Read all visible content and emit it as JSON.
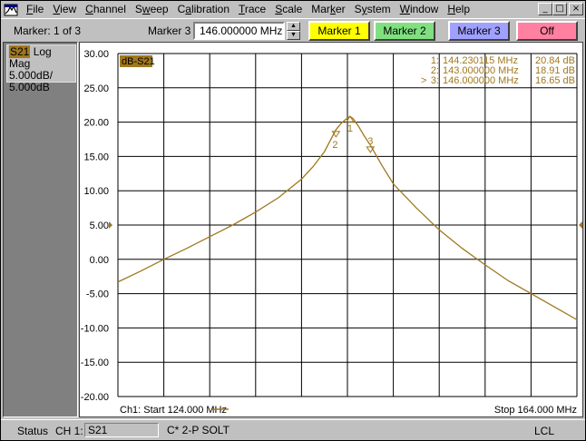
{
  "menu": [
    "File",
    "View",
    "Channel",
    "Sweep",
    "Calibration",
    "Trace",
    "Scale",
    "Marker",
    "System",
    "Window",
    "Help"
  ],
  "menu_underline": [
    "F",
    "V",
    "C",
    "w",
    "a",
    "T",
    "S",
    "k",
    "y",
    "W",
    "H"
  ],
  "window_buttons": [
    "_",
    "□",
    "×"
  ],
  "toolbar": {
    "marker_count": "Marker: 1 of 3",
    "marker_label": "Marker 3",
    "marker_freq": "146.000000 MHz",
    "buttons": [
      {
        "label": "Marker 1",
        "color": "#ffff00"
      },
      {
        "label": "Marker 2",
        "color": "#80e080"
      },
      {
        "label": "Marker 3",
        "color": "#a0a0ff"
      },
      {
        "label": "Off",
        "color": "#ff80a0"
      }
    ]
  },
  "trace": {
    "id": "S21",
    "format": "Log Mag",
    "scale": "5.000dB/",
    "ref": "5.000dB",
    "tag": "dB-S21"
  },
  "markers_table": [
    {
      "active": "",
      "num": "1:",
      "freq": "144.230115 MHz",
      "value": "20.84 dB"
    },
    {
      "active": "",
      "num": "2:",
      "freq": "143.000000 MHz",
      "value": "18.91 dB"
    },
    {
      "active": ">",
      "num": "3:",
      "freq": "146.000000 MHz",
      "value": "16.65 dB"
    }
  ],
  "footer": {
    "start": "Ch1: Start  124.000 MHz",
    "stop": "Stop  164.000 MHz"
  },
  "status": {
    "label": "Status",
    "channel": "CH 1:",
    "param": "S21",
    "cal": "C* 2-P SOLT",
    "mode": "LCL"
  },
  "colors": {
    "trace": "#a0781e",
    "grid": "#000000"
  },
  "chart_data": {
    "type": "line",
    "xlim": [
      124,
      164
    ],
    "ylim": [
      -20,
      30
    ],
    "yticks": [
      "30.00",
      "25.00",
      "20.00",
      "15.00",
      "10.00",
      "5.00",
      "0.00",
      "-5.00",
      "-10.00",
      "-15.00",
      "-20.00"
    ],
    "reference_level": 5,
    "x": [
      124,
      126,
      128,
      130,
      132,
      134,
      136,
      138,
      140,
      141,
      142,
      143,
      143.5,
      144,
      144.23,
      144.5,
      145,
      145.5,
      146,
      147,
      148,
      150,
      152,
      154,
      156,
      158,
      160,
      162,
      164
    ],
    "y": [
      -3.3,
      -1.7,
      0.0,
      1.6,
      3.3,
      5.0,
      6.9,
      9.0,
      11.7,
      13.5,
      15.7,
      18.9,
      19.9,
      20.6,
      20.84,
      20.5,
      19.3,
      17.9,
      16.65,
      13.7,
      11.0,
      7.5,
      4.3,
      1.6,
      -0.8,
      -3.1,
      -5.0,
      -6.9,
      -8.8
    ],
    "markers": [
      {
        "label": "1",
        "x": 144.23,
        "y": 20.84
      },
      {
        "label": "2",
        "x": 143.0,
        "y": 18.91
      },
      {
        "label": "3",
        "x": 146.0,
        "y": 16.65
      }
    ]
  }
}
